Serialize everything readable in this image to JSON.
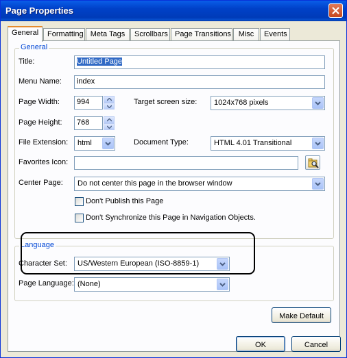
{
  "window": {
    "title": "Page Properties"
  },
  "tabs": [
    "General",
    "Formatting",
    "Meta Tags",
    "Scrollbars",
    "Page Transitions",
    "Misc",
    "Events"
  ],
  "general_group": {
    "label": "General",
    "title_label": "Title:",
    "title_value": "Untitled Page",
    "menu_name_label": "Menu Name:",
    "menu_name_value": "index",
    "page_width_label": "Page Width:",
    "page_width_value": "994",
    "target_screen_label": "Target screen size:",
    "target_screen_value": "1024x768 pixels",
    "page_height_label": "Page Height:",
    "page_height_value": "768",
    "file_ext_label": "File Extension:",
    "file_ext_value": "html",
    "doc_type_label": "Document Type:",
    "doc_type_value": "HTML 4.01 Transitional",
    "favicon_label": "Favorites Icon:",
    "favicon_value": "",
    "center_page_label": "Center Page:",
    "center_page_value": "Do not center this page in the browser window",
    "dont_publish_label": "Don't Publish this Page",
    "dont_sync_label": "Don't Synchronize this Page in Navigation Objects."
  },
  "language_group": {
    "label": "Language",
    "charset_label": "Character Set:",
    "charset_value": "US/Western European (ISO-8859-1)",
    "page_lang_label": "Page Language:",
    "page_lang_value": "(None)"
  },
  "buttons": {
    "make_default": "Make Default",
    "ok": "OK",
    "cancel": "Cancel"
  },
  "colors": {
    "titlebar": "#0041c8",
    "group_label": "#0046d5",
    "active_tab_accent": "#e68b2c",
    "selection": "#316ac5"
  }
}
